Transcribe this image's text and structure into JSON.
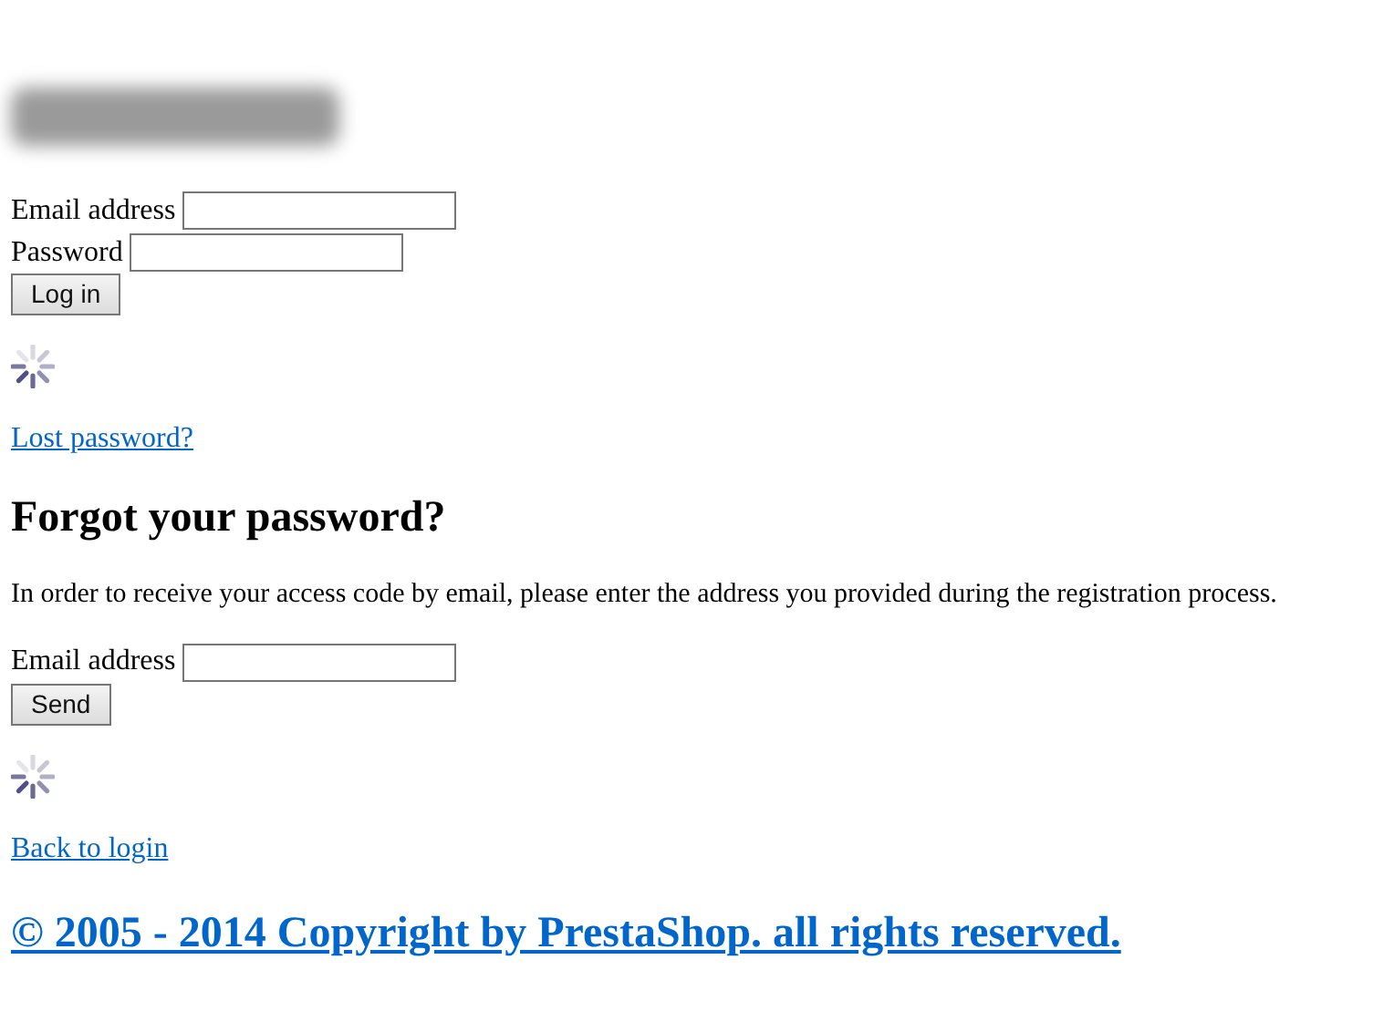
{
  "login_form": {
    "fields": [
      {
        "label": "Email address"
      },
      {
        "label": "Password"
      }
    ],
    "button": "Log in",
    "link": "Lost password?"
  },
  "forgot_password": {
    "heading": "Forgot your password?",
    "text": "In order to receive your access code by email, please enter the address you provided during the registration process.",
    "fields": [
      {
        "label": "Email address"
      }
    ],
    "button": "Send",
    "link": "Back to login"
  },
  "footer": {
    "text": "© 2005 - 2014 Copyright by PrestaShop. all rights reserved."
  }
}
